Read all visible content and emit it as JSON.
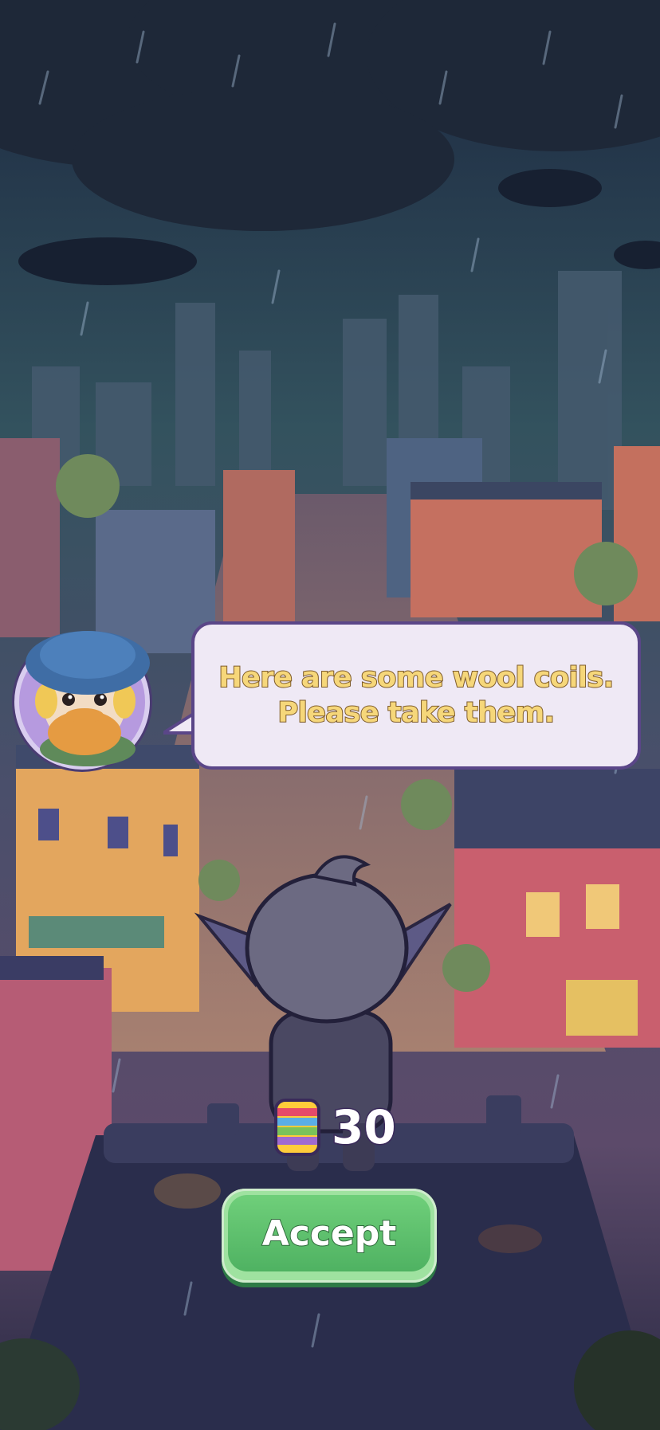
{
  "dialog": {
    "message": "Here are some wool coils.\nPlease take them.",
    "speaker_icon": "old-man-knitted-doll-icon"
  },
  "reward": {
    "icon": "wool-coil-stack-icon",
    "amount": "30"
  },
  "actions": {
    "accept_label": "Accept"
  },
  "colors": {
    "sky": "#2f3f55",
    "bubble_bg": "#efe9f5",
    "bubble_text": "#f6d77a",
    "button_green": "#5abf6b"
  }
}
